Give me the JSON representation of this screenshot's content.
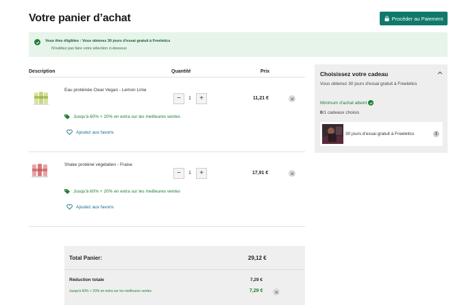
{
  "page": {
    "title": "Votre panier d’achat"
  },
  "header": {
    "checkout_label": "Procéder au Paiement"
  },
  "alert": {
    "line1": "Vous êtes éligibles : Vous obtenez 30 jours d'essai gratuit à Freeletics",
    "line2": "N'oubliez pas faire votre sélection ci-dessous"
  },
  "cart": {
    "columns": {
      "description": "Description",
      "quantity": "Quantité",
      "price": "Prix"
    },
    "items": [
      {
        "name": "Eau protéinée Clear Vegan - Lemon Lime",
        "quantity": "1",
        "price": "11,21 €",
        "promo": "Jusqu'à 60% + 20% en extra sur les meilleures ventes",
        "favorite": "Ajoutez aux favoris"
      },
      {
        "name": "Shake protéiné végétalien - Fraise",
        "quantity": "1",
        "price": "17,91 €",
        "promo": "Jusqu'à 60% + 20% en extra sur les meilleures ventes",
        "favorite": "Ajoutez aux favoris"
      }
    ],
    "stepper": {
      "minus": "−",
      "plus": "+"
    }
  },
  "totals": {
    "total_label": "Total Panier:",
    "total_value": "29,12 €",
    "reduction_label": "Réduction totale",
    "reduction_value": "7,29 €",
    "discount_label": "Jusqu'à 60% + 20% en extra sur les meilleures ventes",
    "discount_value": "7,29 €"
  },
  "gift": {
    "title": "Choisissez votre cadeau",
    "subtitle": "Vous obtenez 30 jours d'essai gratuit à Freeletics",
    "minimum": "Minimum d'achat atteint",
    "count_selected": "0",
    "count_total": "/1 cadeaux choisis",
    "option_name": "30 jours d'essai gratuit à Freeletics",
    "info_glyph": "i"
  },
  "colors": {
    "accent": "#0f7a6b",
    "success": "#1e7d34",
    "link": "#0f6e8c",
    "alert_bg": "#e6f4ea",
    "panel_bg": "#eeeeee"
  },
  "icons": [
    "lock-icon",
    "check-circle-icon",
    "tag-icon",
    "heart-icon",
    "close-icon",
    "chevron-up-icon",
    "info-icon"
  ]
}
